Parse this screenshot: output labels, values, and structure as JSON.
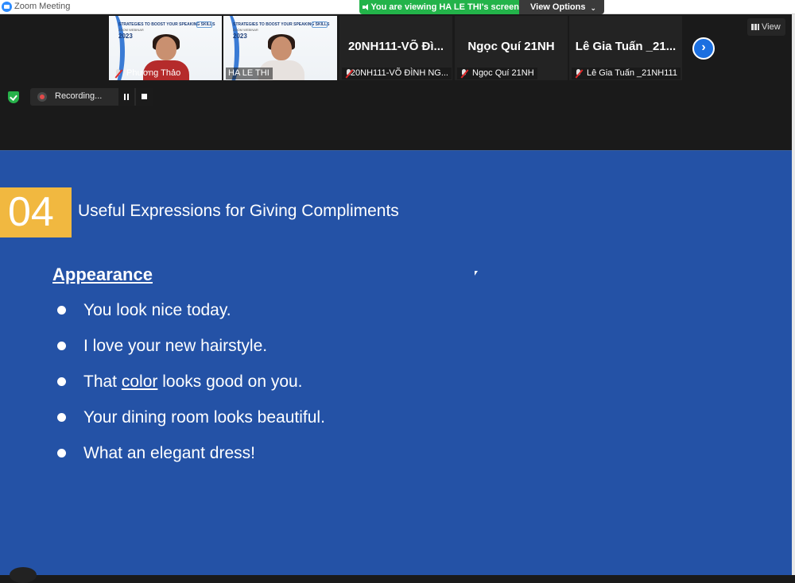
{
  "window": {
    "title": "Zoom Meeting"
  },
  "share_banner": {
    "message": "You are viewing HA LE THI's screen",
    "view_options_label": "View Options",
    "color": "#23b34a"
  },
  "thumbnail_slide": {
    "title": "STRATEGIES TO BOOST YOUR SPEAKING SKILLS",
    "subtitle": "ZOOM WEBINAR",
    "year": "2023"
  },
  "participants": [
    {
      "name": "Phương Thảo",
      "type": "video",
      "muted": true
    },
    {
      "name": "HA LE THI",
      "type": "video",
      "muted": false,
      "active": true
    },
    {
      "name": "20NH111-VÕ ĐÌNH NG...",
      "display": "20NH111-VÕ Đì...",
      "type": "avatar",
      "muted": true
    },
    {
      "name": "Ngọc Quí 21NH",
      "display": "Ngọc Quí 21NH",
      "type": "avatar",
      "muted": true
    },
    {
      "name": "Lê Gia Tuấn _21NH111",
      "display": "Lê Gia Tuấn _21...",
      "type": "avatar",
      "muted": true
    }
  ],
  "view_button": {
    "label": "View"
  },
  "recording": {
    "label": "Recording..."
  },
  "slide": {
    "number": "04",
    "heading": "Useful Expressions for Giving Compliments",
    "category": "Appearance",
    "bullets": {
      "b1": "You look nice today.",
      "b2": "I love your new hairstyle.",
      "b3_pre": "That ",
      "b3_underlined": "color",
      "b3_post": " looks good on you.",
      "b4": "Your dining room looks beautiful.",
      "b5": "What an elegant dress!"
    },
    "background_color": "#2452a6",
    "number_box_color": "#f1b840"
  }
}
